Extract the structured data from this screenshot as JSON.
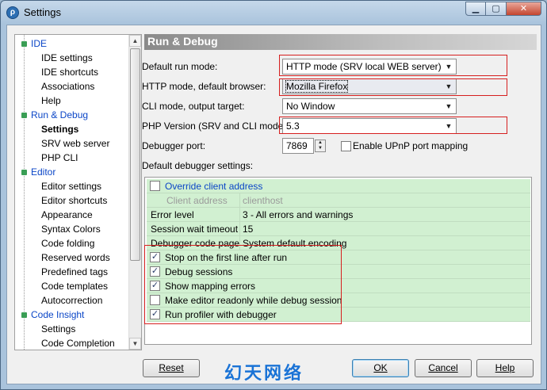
{
  "window": {
    "title": "Settings"
  },
  "tree": {
    "items": [
      {
        "label": "IDE",
        "level": 0
      },
      {
        "label": "IDE settings",
        "level": 1
      },
      {
        "label": "IDE shortcuts",
        "level": 1
      },
      {
        "label": "Associations",
        "level": 1
      },
      {
        "label": "Help",
        "level": 1
      },
      {
        "label": "Run & Debug",
        "level": 0
      },
      {
        "label": "Settings",
        "level": 1,
        "selected": true
      },
      {
        "label": "SRV web server",
        "level": 1
      },
      {
        "label": "PHP CLI",
        "level": 1
      },
      {
        "label": "Editor",
        "level": 0
      },
      {
        "label": "Editor settings",
        "level": 1
      },
      {
        "label": "Editor shortcuts",
        "level": 1
      },
      {
        "label": "Appearance",
        "level": 1
      },
      {
        "label": "Syntax Colors",
        "level": 1
      },
      {
        "label": "Code folding",
        "level": 1
      },
      {
        "label": "Reserved words",
        "level": 1
      },
      {
        "label": "Predefined tags",
        "level": 1
      },
      {
        "label": "Code templates",
        "level": 1
      },
      {
        "label": "Autocorrection",
        "level": 1
      },
      {
        "label": "Code Insight",
        "level": 0
      },
      {
        "label": "Settings",
        "level": 1
      },
      {
        "label": "Code Completion",
        "level": 1
      }
    ]
  },
  "panel": {
    "title": "Run & Debug",
    "default_run_mode": {
      "label": "Default run mode:",
      "value": "HTTP mode (SRV local WEB server)"
    },
    "browser": {
      "label": "HTTP mode, default browser:",
      "value": "Mozilla Firefox"
    },
    "cli_target": {
      "label": "CLI mode, output target:",
      "value": "No Window"
    },
    "php_version": {
      "label": "PHP Version (SRV and CLI modes):",
      "value": "5.3"
    },
    "debugger_port": {
      "label": "Debugger port:",
      "value": "7869"
    },
    "upnp": {
      "label": "Enable UPnP port mapping",
      "checked": false
    },
    "debugger_settings_label": "Default debugger settings:",
    "grid": {
      "override": {
        "label": "Override client address",
        "checked": false
      },
      "rows": [
        {
          "name": "Client address",
          "value": "clienthost",
          "disabled": true
        },
        {
          "name": "Error level",
          "value": "3 - All errors and warnings"
        },
        {
          "name": "Session wait timeout",
          "value": "15"
        },
        {
          "name": "Debugger code page",
          "value": "System default encoding"
        }
      ],
      "checks": [
        {
          "label": "Stop on the first line after run",
          "checked": true
        },
        {
          "label": "Debug sessions",
          "checked": true
        },
        {
          "label": "Show mapping errors",
          "checked": true
        },
        {
          "label": "Make editor readonly while debug session",
          "checked": false
        },
        {
          "label": "Run profiler with debugger",
          "checked": true
        }
      ]
    }
  },
  "buttons": {
    "reset": "Reset",
    "ok": "OK",
    "cancel": "Cancel",
    "help": "Help"
  },
  "watermark": "幻天网络",
  "colors": {
    "highlight_red": "#d61f1f",
    "grid_green": "#d1f0d1",
    "link_blue": "#0b46c7"
  }
}
